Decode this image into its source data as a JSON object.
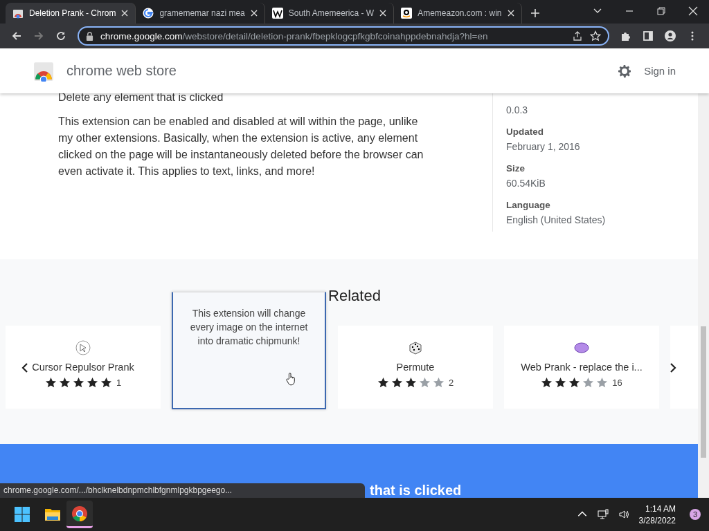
{
  "browser": {
    "tabs": [
      {
        "title": "Deletion Prank - Chrom",
        "kind": "store",
        "selected": true
      },
      {
        "title": "gramememar nazi mea",
        "kind": "google",
        "selected": false
      },
      {
        "title": "South Amemeerica - W",
        "kind": "wiki",
        "selected": false
      },
      {
        "title": "Amemeazon.com : win",
        "kind": "amazon",
        "selected": false
      }
    ],
    "url_host": "chrome.google.com",
    "url_path": "/webstore/detail/deletion-prank/fbepklogcpfkgbfcoinahppdebnahdja?hl=en"
  },
  "header": {
    "title": "chrome web store",
    "sign_in": "Sign in"
  },
  "description": {
    "summary": "Delete any element that is clicked",
    "body": "This extension can be enabled and disabled at will within the page, unlike my other extensions. Basically, when the extension is active, any element clicked on the page will be instantaneously deleted before the browser can even activate it. This applies to text, links, and more!"
  },
  "details": [
    {
      "value": "0.0.3"
    },
    {
      "label": "Updated",
      "value": "February 1, 2016"
    },
    {
      "label": "Size",
      "value": "60.54KiB"
    },
    {
      "label": "Language",
      "value": "English (United States)"
    }
  ],
  "related": {
    "title": "Related",
    "cards": [
      {
        "kind": "card",
        "name": "Cursor Repulsor Prank",
        "stars": 5,
        "count": "1"
      },
      {
        "kind": "hover",
        "description": "This extension will change every image on the internet into dramatic chipmunk!"
      },
      {
        "kind": "card",
        "name": "Permute",
        "stars": 3,
        "count": "2"
      },
      {
        "kind": "card",
        "name": "Web Prank - replace the i...",
        "stars": 3,
        "count": "16"
      },
      {
        "kind": "blank"
      }
    ]
  },
  "banner": {
    "text": "that is clicked"
  },
  "status_url": "chrome.google.com/.../bhclknelbdnpmchlbfgnmlpgkbpgeego...",
  "taskbar": {
    "time": "1:14 AM",
    "date": "3/28/2022",
    "notifications": "3"
  }
}
